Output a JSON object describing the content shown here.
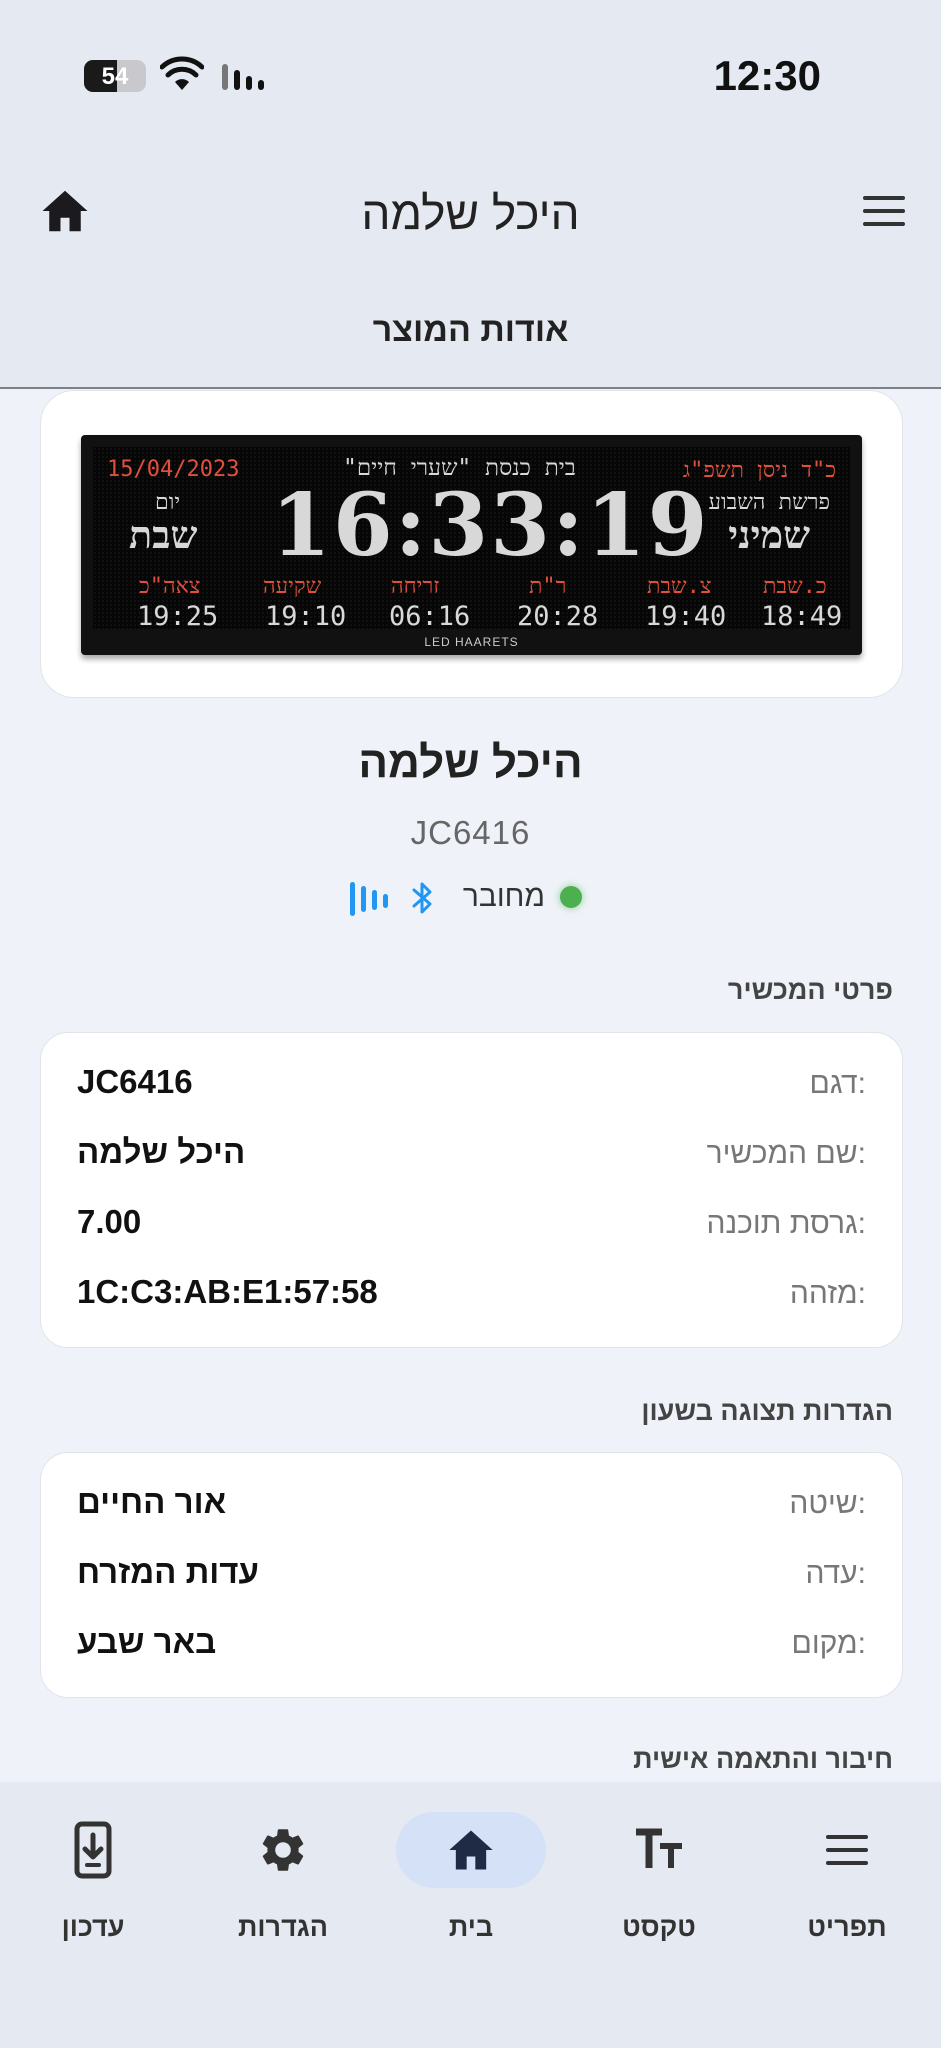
{
  "status_bar": {
    "time": "12:30",
    "battery_level": "54",
    "battery_fraction": 0.54
  },
  "app_bar": {
    "title": "היכל שלמה"
  },
  "sub_bar": {
    "label": "אודות המוצר"
  },
  "led_display": {
    "gregorian_date": "15/04/2023",
    "hebrew_date": "כ\"ד ניסן תשפ\"ג",
    "synagogue": "בית כנסת \"שערי חיים\"",
    "day_label": "יום",
    "day": "שבת",
    "parasha_label": "פרשת השבוע",
    "parasha": "שמיני",
    "clock": "16:33:19",
    "times": [
      {
        "label": "צאה\"כ",
        "value": "19:25"
      },
      {
        "label": "שקיעה",
        "value": "19:10"
      },
      {
        "label": "זריחה",
        "value": "06:16"
      },
      {
        "label": "ר\"ת",
        "value": "20:28"
      },
      {
        "label": "צ.שבת",
        "value": "19:40"
      },
      {
        "label": "כ.שבת",
        "value": "18:49"
      }
    ],
    "brand": "LED HAARETS"
  },
  "device": {
    "name": "היכל שלמה",
    "serial": "JC6416",
    "status": "מחובר"
  },
  "details": {
    "title": "פרטי המכשיר",
    "rows": [
      {
        "key": "דגם:",
        "value": "JC6416"
      },
      {
        "key": "שם המכשיר:",
        "value": "היכל שלמה"
      },
      {
        "key": "גרסת תוכנה:",
        "value": "7.00"
      },
      {
        "key": "מזהה:",
        "value": "1C:C3:AB:E1:57:58"
      }
    ]
  },
  "clock_settings": {
    "title": "הגדרות תצוגה בשעון",
    "rows": [
      {
        "key": "שיטה:",
        "value": "אור החיים"
      },
      {
        "key": "עדה:",
        "value": "עדות המזרח"
      },
      {
        "key": "מקום:",
        "value": "באר שבע"
      }
    ]
  },
  "next_section": {
    "title": "חיבור והתאמה אישית"
  },
  "bottom_nav": {
    "items": [
      {
        "label": "עדכון",
        "icon": "download-phone-icon"
      },
      {
        "label": "הגדרות",
        "icon": "gear-icon"
      },
      {
        "label": "בית",
        "icon": "home-icon",
        "active": true
      },
      {
        "label": "טקסט",
        "icon": "text-size-icon"
      },
      {
        "label": "תפריט",
        "icon": "menu-icon"
      }
    ]
  },
  "colors": {
    "connected": "#4caf50",
    "bluetooth": "#2196f3",
    "active_nav": "#d4e1f7",
    "led_red": "#e0503c"
  }
}
